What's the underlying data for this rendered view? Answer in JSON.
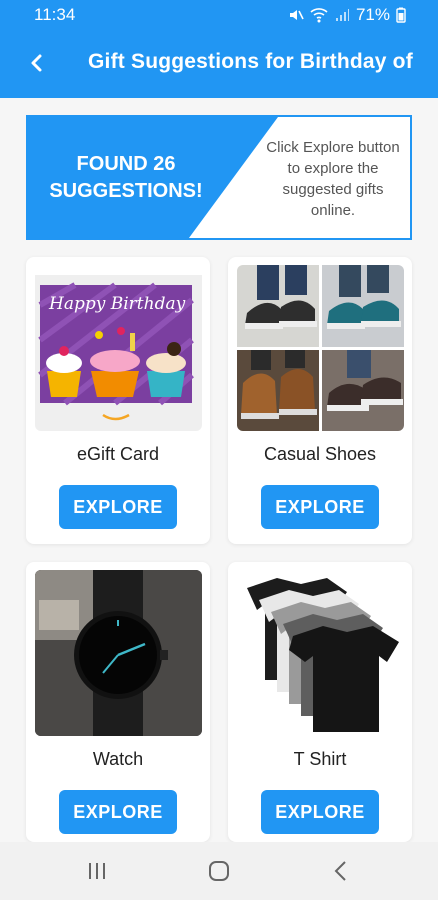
{
  "status": {
    "time": "11:34",
    "battery": "71%"
  },
  "header": {
    "title": "Gift Suggestions for Birthday of "
  },
  "banner": {
    "found_text": "FOUND 26 SUGGESTIONS!",
    "hint_text": "Click Explore button to explore the suggested gifts online."
  },
  "cards": [
    {
      "name": "eGift Card",
      "button": "EXPLORE",
      "image": "Happy Birthday"
    },
    {
      "name": "Casual Shoes",
      "button": "EXPLORE"
    },
    {
      "name": "Watch",
      "button": "EXPLORE"
    },
    {
      "name": "T Shirt",
      "button": "EXPLORE"
    }
  ],
  "colors": {
    "primary": "#2196f3",
    "background": "#f6f6f6"
  }
}
